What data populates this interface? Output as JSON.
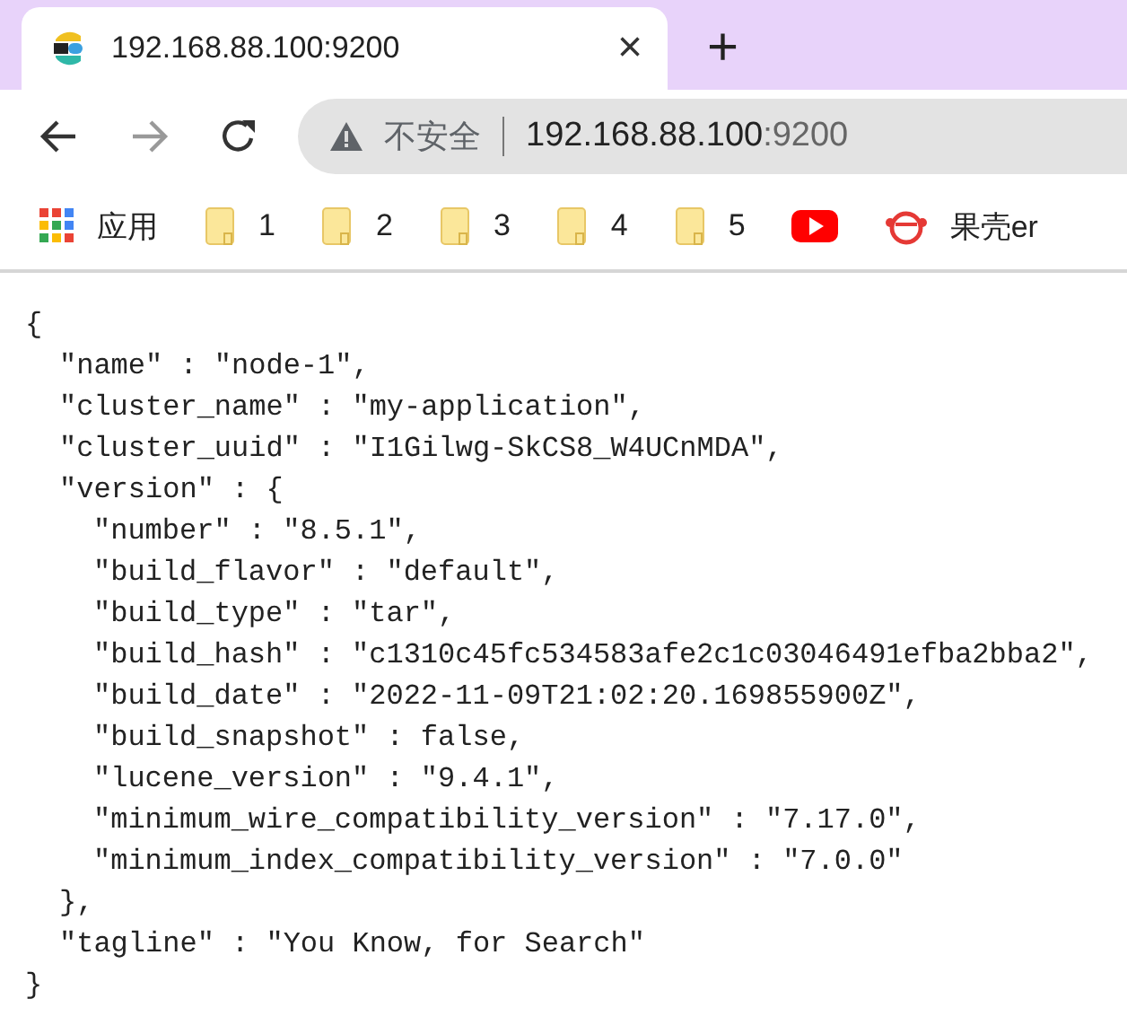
{
  "tab": {
    "title": "192.168.88.100:9200",
    "selected": true
  },
  "new_tab": "+",
  "close": "×",
  "address_bar": {
    "security_label": "不安全",
    "host": "192.168.88.100",
    "port": ":9200"
  },
  "bookmarks": [
    {
      "kind": "apps",
      "label": "应用"
    },
    {
      "kind": "folder",
      "label": "1"
    },
    {
      "kind": "folder",
      "label": "2"
    },
    {
      "kind": "folder",
      "label": "3"
    },
    {
      "kind": "folder",
      "label": "4"
    },
    {
      "kind": "folder",
      "label": "5"
    },
    {
      "kind": "video"
    },
    {
      "kind": "monkey",
      "label": "果壳er"
    }
  ],
  "body": [
    {
      "text": "{",
      "children": [
        {
          "text": "\"name\" : \"node-1\","
        },
        {
          "text": "\"cluster_name\" : \"my-application\","
        },
        {
          "text": "\"cluster_uuid\" : \"I1Gilwg-SkCS8_W4UCnMDA\","
        },
        {
          "text": "\"version\" : {",
          "children": [
            {
              "text": "\"number\" : \"8.5.1\","
            },
            {
              "text": "\"build_flavor\" : \"default\","
            },
            {
              "text": "\"build_type\" : \"tar\","
            },
            {
              "text": "\"build_hash\" : \"c1310c45fc534583afe2c1c03046491efba2bba2\","
            },
            {
              "text": "\"build_date\" : \"2022-11-09T21:02:20.169855900Z\","
            },
            {
              "text": "\"build_snapshot\" : false,"
            },
            {
              "text": "\"lucene_version\" : \"9.4.1\","
            },
            {
              "text": "\"minimum_wire_compatibility_version\" : \"7.17.0\","
            },
            {
              "text": "\"minimum_index_compatibility_version\" : \"7.0.0\""
            }
          ]
        },
        {
          "text": "},"
        },
        {
          "text": "\"tagline\" : \"You Know, for Search\""
        }
      ]
    },
    {
      "text": "}"
    }
  ]
}
